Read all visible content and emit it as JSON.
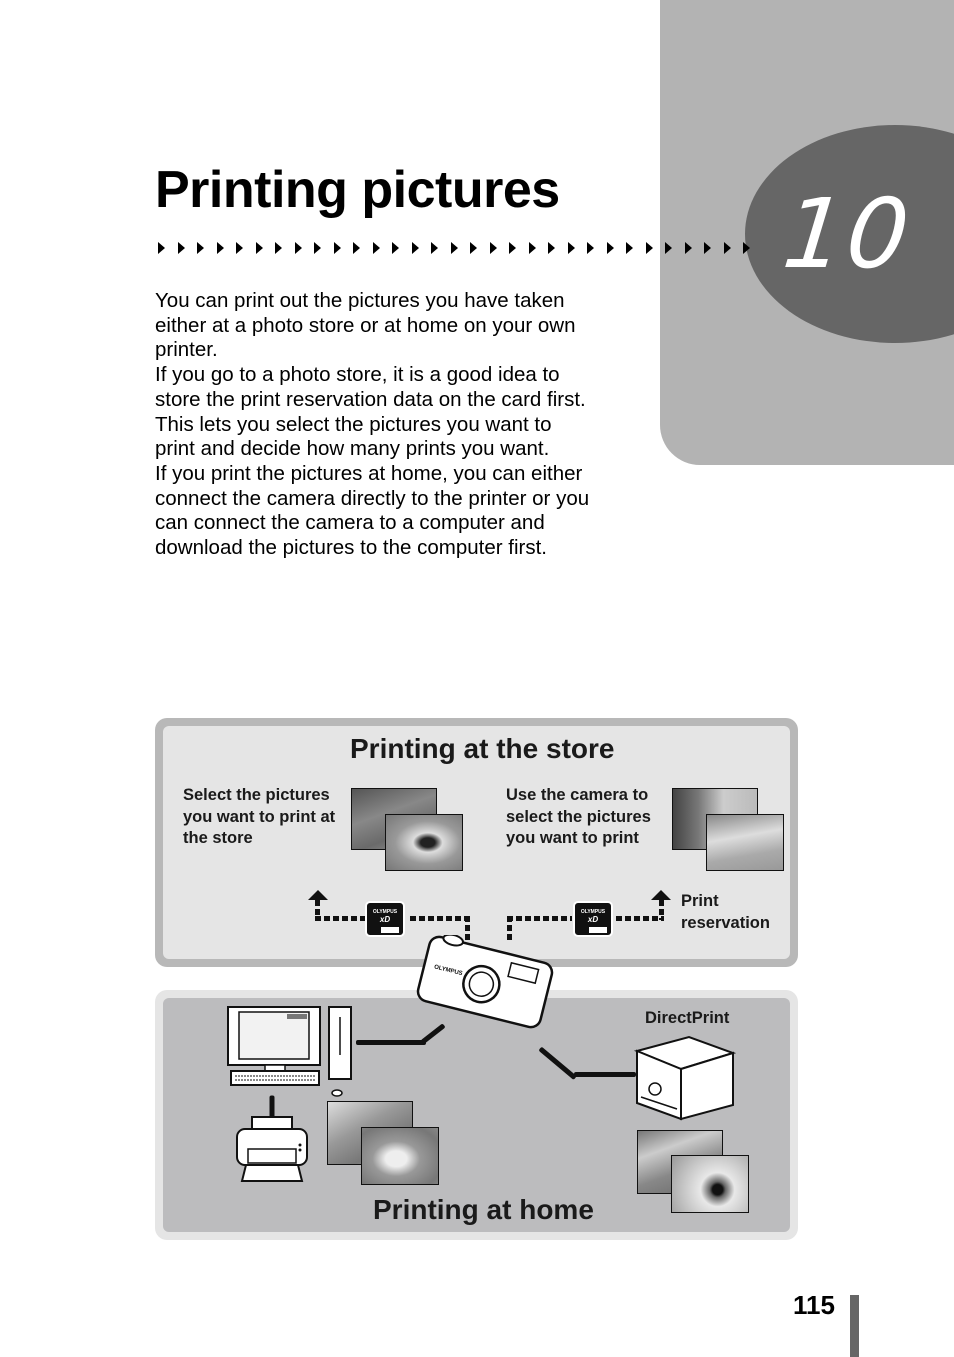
{
  "chapter": {
    "number": "10",
    "title": "Printing pictures",
    "arrow_count": 31
  },
  "intro": {
    "paragraphs": [
      "You can print out the pictures you have taken either at a photo store or at home on your own printer.",
      "If you go to a photo store, it is a good idea to store the print reservation data on the card first. This lets you select the pictures you want to print and decide how many prints you want.",
      "If you print the pictures at home, you can either connect the camera directly to the printer or you can connect the camera to a computer and download the pictures to the computer first."
    ]
  },
  "diagram": {
    "store": {
      "title": "Printing at the store",
      "left_caption": "Select the pictures you want to print at the store",
      "right_caption": "Use the camera to select the pictures you want to print",
      "reservation_label": "Print reservation",
      "card_brand": "OLYMPUS",
      "card_logo": "xD"
    },
    "home": {
      "title": "Printing at home",
      "directprint_label": "DirectPrint"
    },
    "camera_brand": "OLYMPUS"
  },
  "footer": {
    "page_number": "115"
  },
  "colors": {
    "tab_gray": "#b3b3b3",
    "oval_gray": "#666666",
    "store_bg": "#e5e5e5",
    "home_bg": "#bcbcbe"
  }
}
